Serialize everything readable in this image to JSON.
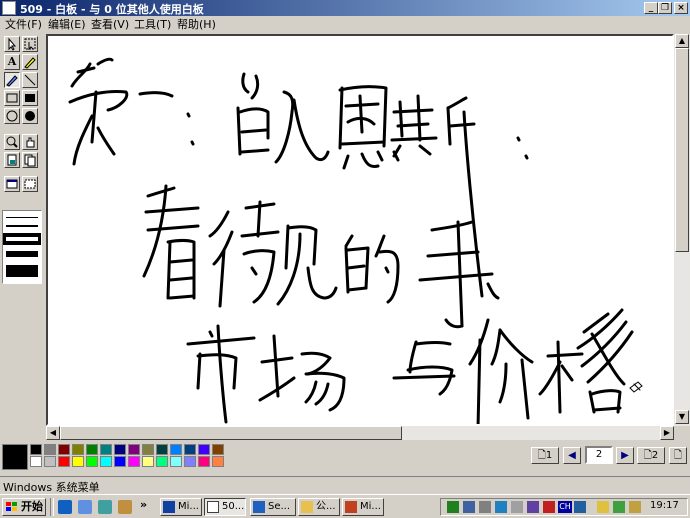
{
  "window": {
    "title": "509 - 白板 - 与 0 位其他人使用白板",
    "minimize_glyph": "_",
    "restore_glyph": "❐",
    "close_glyph": "×"
  },
  "menu": [
    {
      "label": "文件(F)"
    },
    {
      "label": "编辑(E)"
    },
    {
      "label": "查看(V)"
    },
    {
      "label": "工具(T)"
    },
    {
      "label": "帮助(H)"
    }
  ],
  "tools": {
    "text_tool_glyph": "A"
  },
  "palette": {
    "current": "#000000",
    "row1": [
      "#000000",
      "#808080",
      "#800000",
      "#808000",
      "#008000",
      "#008080",
      "#000080",
      "#800080",
      "#808040",
      "#004040",
      "#0080ff",
      "#004080",
      "#4000ff",
      "#804000"
    ],
    "row2": [
      "#ffffff",
      "#c0c0c0",
      "#ff0000",
      "#ffff00",
      "#00ff00",
      "#00ffff",
      "#0000ff",
      "#ff00ff",
      "#ffff80",
      "#00ff80",
      "#80ffff",
      "#8080ff",
      "#ff0080",
      "#ff8040"
    ]
  },
  "pagination": {
    "first_label": "1",
    "current_page": "2",
    "last_label": "2"
  },
  "status": {
    "text": "Windows 系统菜单"
  },
  "taskbar": {
    "start_label": "开始",
    "more_glyph": "»",
    "buttons": [
      {
        "label": "Mi..."
      },
      {
        "label": "50..."
      },
      {
        "label": "Se..."
      },
      {
        "label": "公..."
      },
      {
        "label": "Mi..."
      }
    ],
    "tray_lang": "CH",
    "clock": "19:17"
  }
}
